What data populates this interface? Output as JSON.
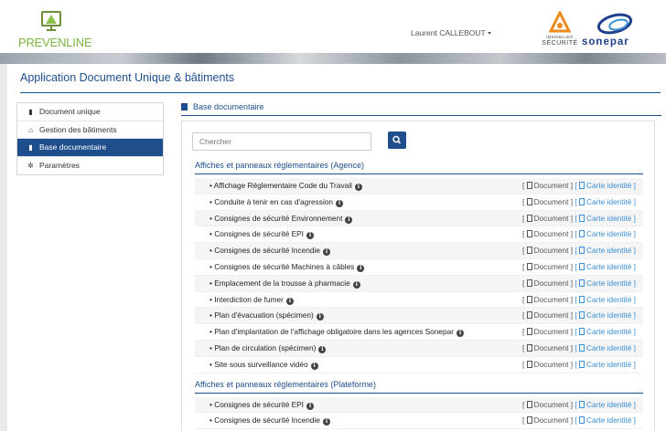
{
  "header": {
    "brand": "PREVENLINE",
    "user_name": "Laurent CALLEBOUT",
    "partner_immo_top": "IMMOBILIER",
    "partner_immo_bottom": "SÉCURITÉ",
    "partner_sonepar": "sonepar"
  },
  "app_title": "Application Document Unique & bâtiments",
  "sidebar": {
    "items": [
      {
        "label": "Document unique",
        "icon": "file-icon",
        "glyph": "▮"
      },
      {
        "label": "Gestion des bâtiments",
        "icon": "home-icon",
        "glyph": "⌂"
      },
      {
        "label": "Base documentaire",
        "icon": "book-icon",
        "glyph": "▮",
        "active": true
      },
      {
        "label": "Paramètres",
        "icon": "gear-icon",
        "glyph": "✲"
      }
    ]
  },
  "section": {
    "title": "Base documentaire"
  },
  "search": {
    "placeholder": "Chercher"
  },
  "link_labels": {
    "document": "Document",
    "carte": "Carte identité"
  },
  "groups": [
    {
      "title": "Affiches et panneaux réglementaires (Agence)",
      "items": [
        "Affichage Réglementaire Code du Travail",
        "Conduite à tenir en cas d'agression",
        "Consignes de sécurité Environnement",
        "Consignes de sécurité EPI",
        "Consignes de sécurité Incendie",
        "Consignes de sécurité Machines à câbles",
        "Emplacement de la trousse à pharmacie",
        "Interdiction de fumer",
        "Plan d'évacuation (spécimen)",
        "Plan d'implantation de l'affichage obligatoire dans les agences Sonepar",
        "Plan de circulation (spécimen)",
        "Site sous surveillance vidéo"
      ]
    },
    {
      "title": "Affiches et panneaux réglementaires (Plateforme)",
      "items": [
        "Consignes de sécurité EPI",
        "Consignes de sécurité Incendie"
      ]
    }
  ],
  "colors": {
    "primary": "#1f4e8c",
    "link": "#3a8fd6",
    "brand_green": "#7cb342",
    "immo_orange": "#f08a1c"
  }
}
